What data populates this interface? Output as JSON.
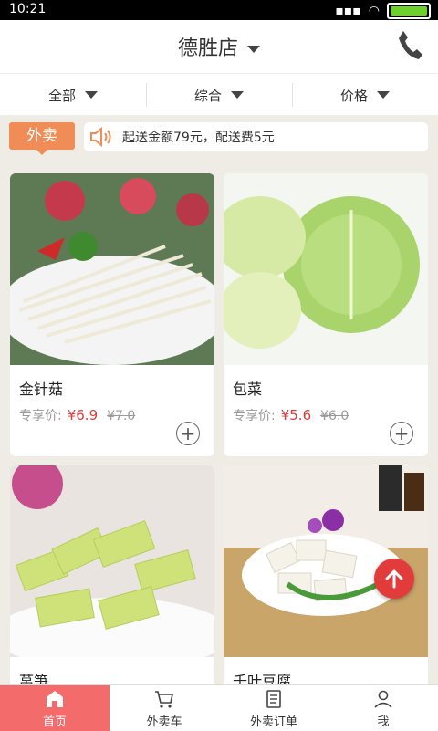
{
  "status": {
    "time": "10:21"
  },
  "header": {
    "store_name": "德胜店"
  },
  "filters": [
    {
      "label": "全部"
    },
    {
      "label": "综合"
    },
    {
      "label": "价格"
    }
  ],
  "notice": {
    "tag": "外卖",
    "text": "起送金额79元，配送费5元"
  },
  "products": [
    {
      "name": "金针菇",
      "price_label": "专享价:",
      "price": "¥6.9",
      "old_price": "¥7.0"
    },
    {
      "name": "包菜",
      "price_label": "专享价:",
      "price": "¥5.6",
      "old_price": "¥6.0"
    },
    {
      "name": "莴笋",
      "price_label": "",
      "price": "",
      "old_price": ""
    },
    {
      "name": "千叶豆腐",
      "price_label": "",
      "price": "",
      "old_price": ""
    }
  ],
  "tabs": [
    {
      "label": "首页",
      "icon": "home-icon"
    },
    {
      "label": "外卖车",
      "icon": "cart-icon"
    },
    {
      "label": "外卖订单",
      "icon": "order-icon"
    },
    {
      "label": "我",
      "icon": "user-icon"
    }
  ],
  "colors": {
    "accent": "#f36b6b",
    "price": "#e03a3a",
    "tag": "#f08c56"
  }
}
